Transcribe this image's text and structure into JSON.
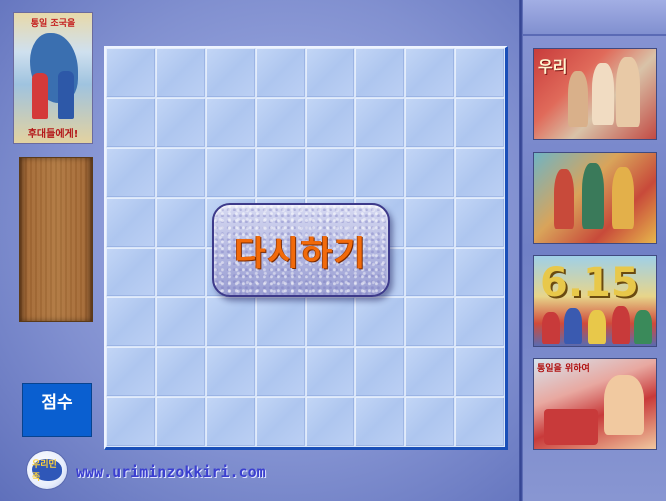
{
  "left_panel": {
    "poster_top_text": "통일 조국을",
    "poster_slogan": "후대들에게!",
    "score_label": "점수",
    "score_value": ""
  },
  "board": {
    "rows": 8,
    "cols": 8,
    "restart_label": "다시하기"
  },
  "footer": {
    "logo_text": "우리민족",
    "site_url": "www.uriminzokkiri.com"
  },
  "right_panel": {
    "posters": [
      {
        "title": "우리",
        "caption": ""
      },
      {
        "title": "",
        "caption": ""
      },
      {
        "title": "6.15",
        "caption": ""
      },
      {
        "title": "",
        "head": "통일을 위하여",
        "caption": ""
      }
    ]
  },
  "colors": {
    "accent": "#f26a0a",
    "score_box": "#0a5fd0",
    "board_border": "#1a4fb8",
    "url_text": "#3b3fd0"
  }
}
